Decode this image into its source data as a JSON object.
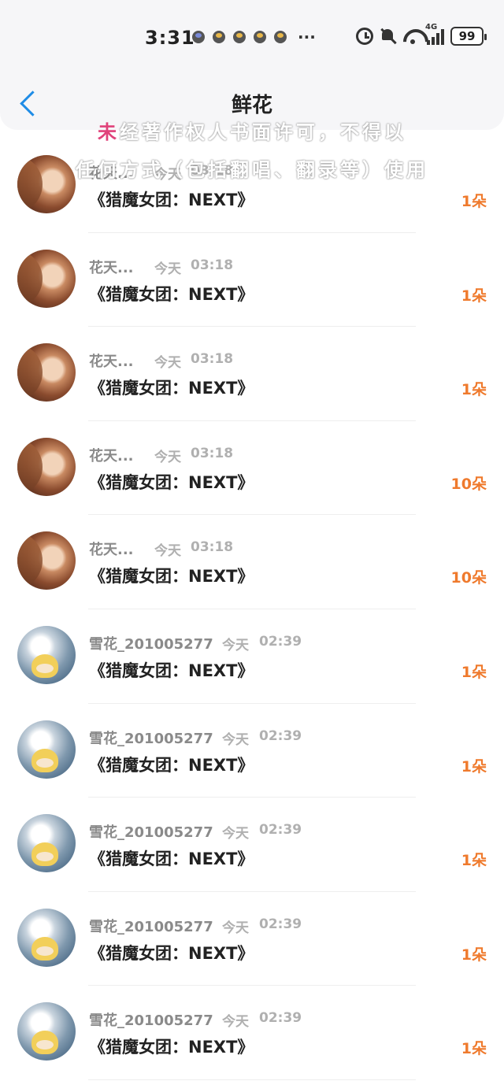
{
  "status_bar": {
    "time": "3:31",
    "network": "4G",
    "battery": "99",
    "more": "···"
  },
  "header": {
    "title": "鲜花"
  },
  "watermark": {
    "line1": "未经著作权人书面许可，不得以",
    "line2": "任何方式（包括翻唱、翻录等）使用"
  },
  "rows": [
    {
      "user": "花天...",
      "date": "今天",
      "time": "03:18",
      "gift": "《猎魔女团：NEXT》",
      "count": "1朵",
      "avatar": "portrait"
    },
    {
      "user": "花天...",
      "date": "今天",
      "time": "03:18",
      "gift": "《猎魔女团：NEXT》",
      "count": "1朵",
      "avatar": "portrait"
    },
    {
      "user": "花天...",
      "date": "今天",
      "time": "03:18",
      "gift": "《猎魔女团：NEXT》",
      "count": "1朵",
      "avatar": "portrait"
    },
    {
      "user": "花天...",
      "date": "今天",
      "time": "03:18",
      "gift": "《猎魔女团：NEXT》",
      "count": "10朵",
      "avatar": "portrait"
    },
    {
      "user": "花天...",
      "date": "今天",
      "time": "03:18",
      "gift": "《猎魔女团：NEXT》",
      "count": "10朵",
      "avatar": "portrait"
    },
    {
      "user": "雪花_201005277",
      "date": "今天",
      "time": "02:39",
      "gift": "《猎魔女团：NEXT》",
      "count": "1朵",
      "avatar": "anime"
    },
    {
      "user": "雪花_201005277",
      "date": "今天",
      "time": "02:39",
      "gift": "《猎魔女团：NEXT》",
      "count": "1朵",
      "avatar": "anime"
    },
    {
      "user": "雪花_201005277",
      "date": "今天",
      "time": "02:39",
      "gift": "《猎魔女团：NEXT》",
      "count": "1朵",
      "avatar": "anime"
    },
    {
      "user": "雪花_201005277",
      "date": "今天",
      "time": "02:39",
      "gift": "《猎魔女团：NEXT》",
      "count": "1朵",
      "avatar": "anime"
    },
    {
      "user": "雪花_201005277",
      "date": "今天",
      "time": "02:39",
      "gift": "《猎魔女团：NEXT》",
      "count": "1朵",
      "avatar": "anime"
    }
  ],
  "colors": {
    "accent": "#1f8ce6",
    "count": "#ef7a2d"
  }
}
